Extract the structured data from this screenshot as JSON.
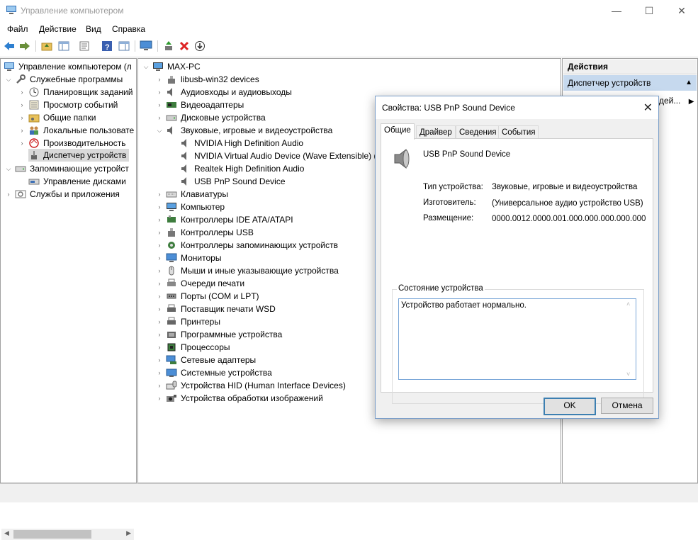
{
  "window": {
    "title": "Управление компьютером",
    "minimize": "—",
    "maximize": "☐",
    "close": "✕"
  },
  "menu": [
    "Файл",
    "Действие",
    "Вид",
    "Справка"
  ],
  "toolbar": {
    "icons": [
      "back-icon",
      "forward-icon",
      "up-folder-icon",
      "show-tree-icon",
      "properties-icon",
      "help-icon",
      "action-pane-icon",
      "monitor-icon",
      "update-driver-icon",
      "uninstall-icon",
      "disable-icon"
    ]
  },
  "left_tree": {
    "root": "Управление компьютером (л",
    "items": [
      {
        "label": "Служебные программы"
      },
      {
        "label": "Планировщик заданий"
      },
      {
        "label": "Просмотр событий"
      },
      {
        "label": "Общие папки"
      },
      {
        "label": "Локальные пользовате"
      },
      {
        "label": "Производительность"
      },
      {
        "label": "Диспетчер устройств"
      },
      {
        "label": "Запоминающие устройст"
      },
      {
        "label": "Управление дисками"
      },
      {
        "label": "Службы и приложения"
      }
    ]
  },
  "device_tree": {
    "root": "MAX-PC",
    "items": [
      {
        "label": "libusb-win32 devices"
      },
      {
        "label": "Аудиовходы и аудиовыходы"
      },
      {
        "label": "Видеоадаптеры"
      },
      {
        "label": "Дисковые устройства"
      },
      {
        "label": "Звуковые, игровые и видеоустройства"
      },
      {
        "label": "NVIDIA High Definition Audio"
      },
      {
        "label": "NVIDIA Virtual Audio Device (Wave Extensible) (W"
      },
      {
        "label": "Realtek High Definition Audio"
      },
      {
        "label": "USB PnP Sound Device"
      },
      {
        "label": "Клавиатуры"
      },
      {
        "label": "Компьютер"
      },
      {
        "label": "Контроллеры IDE ATA/ATAPI"
      },
      {
        "label": "Контроллеры USB"
      },
      {
        "label": "Контроллеры запоминающих устройств"
      },
      {
        "label": "Мониторы"
      },
      {
        "label": "Мыши и иные указывающие устройства"
      },
      {
        "label": "Очереди печати"
      },
      {
        "label": "Порты (COM и LPT)"
      },
      {
        "label": "Поставщик печати WSD"
      },
      {
        "label": "Принтеры"
      },
      {
        "label": "Программные устройства"
      },
      {
        "label": "Процессоры"
      },
      {
        "label": "Сетевые адаптеры"
      },
      {
        "label": "Системные устройства"
      },
      {
        "label": "Устройства HID (Human Interface Devices)"
      },
      {
        "label": "Устройства обработки изображений"
      }
    ]
  },
  "actions": {
    "title": "Действия",
    "subtitle": "Диспетчер устройств",
    "more": "дей..."
  },
  "dialog": {
    "title": "Свойства: USB PnP Sound Device",
    "tabs": [
      "Общие",
      "Драйвер",
      "Сведения",
      "События"
    ],
    "device_name": "USB PnP Sound Device",
    "props": [
      {
        "label": "Тип устройства:",
        "value": "Звуковые, игровые и видеоустройства"
      },
      {
        "label": "Изготовитель:",
        "value": "(Универсальное аудио устройство USB)"
      },
      {
        "label": "Размещение:",
        "value": "0000.0012.0000.001.000.000.000.000.000"
      }
    ],
    "status_group": "Состояние устройства",
    "status_text": "Устройство работает нормально.",
    "ok": "OK",
    "cancel": "Отмена"
  }
}
